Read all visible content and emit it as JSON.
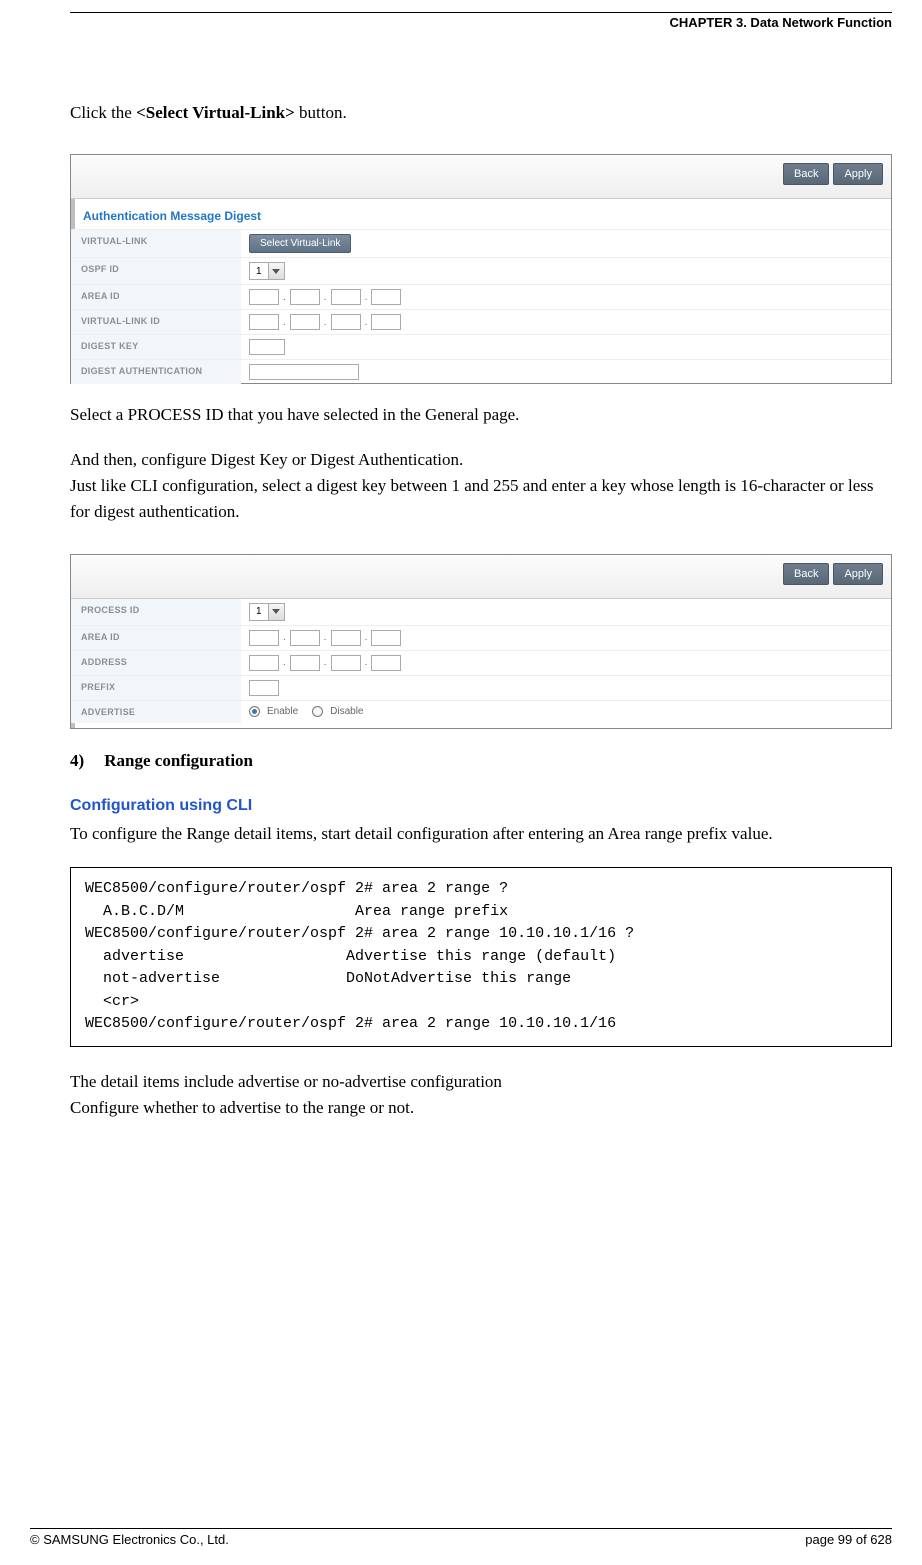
{
  "header": {
    "title": "CHAPTER 3. Data Network Function"
  },
  "intro": {
    "click_prefix": "Click the ",
    "click_bold": "<Select Virtual-Link>",
    "click_suffix": " button."
  },
  "fig1": {
    "back": "Back",
    "apply": "Apply",
    "section": "Authentication Message Digest",
    "rows": {
      "virtual_link": "VIRTUAL-LINK",
      "select_btn": "Select Virtual-Link",
      "ospf_id": "OSPF ID",
      "ospf_id_val": "1",
      "area_id": "AREA ID",
      "vlink_id": "VIRTUAL-LINK ID",
      "digest_key": "DIGEST KEY",
      "digest_auth": "DIGEST AUTHENTICATION"
    }
  },
  "mid": {
    "p1": "Select a PROCESS ID that you have selected in the General page.",
    "p2": "And then, configure Digest Key or Digest Authentication.",
    "p3": "Just like CLI configuration, select a digest key between 1 and 255 and enter a key whose length is 16-character or less for digest authentication."
  },
  "fig2": {
    "back": "Back",
    "apply": "Apply",
    "rows": {
      "process_id": "PROCESS ID",
      "process_id_val": "1",
      "area_id": "AREA ID",
      "address": "ADDRESS",
      "prefix": "PREFIX",
      "advertise": "ADVERTISE",
      "enable": "Enable",
      "disable": "Disable"
    }
  },
  "range": {
    "heading_num": "4)",
    "heading": "Range configuration",
    "cli_heading": "Configuration using CLI",
    "cli_intro": "To configure the Range detail items, start detail configuration after entering an Area range prefix value.",
    "code": "WEC8500/configure/router/ospf 2# area 2 range ?\n  A.B.C.D/M                   Area range prefix\nWEC8500/configure/router/ospf 2# area 2 range 10.10.10.1/16 ?\n  advertise                  Advertise this range (default)\n  not-advertise              DoNotAdvertise this range\n  <cr>\nWEC8500/configure/router/ospf 2# area 2 range 10.10.10.1/16",
    "outro1": "The detail items include advertise or no-advertise configuration",
    "outro2": "Configure whether to advertise to the range or not."
  },
  "footer": {
    "left": "© SAMSUNG Electronics Co., Ltd.",
    "right": "page 99 of 628"
  }
}
